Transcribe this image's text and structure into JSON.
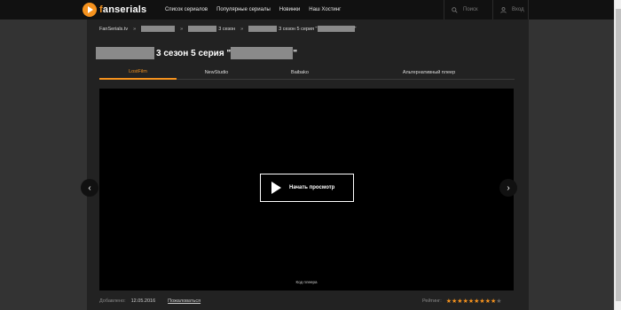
{
  "header": {
    "logo_prefix": "f",
    "logo_rest": "anserials",
    "nav": [
      "Список сериалов",
      "Популярные сериалы",
      "Новинки",
      "Наш Хостинг"
    ],
    "search_label": "Поиск",
    "login_label": "Вход"
  },
  "breadcrumb": {
    "home": "FanSerials.tv",
    "separator": "»",
    "season_suffix": "3 сезон",
    "episode_text": "3 сезон 5 серия \""
  },
  "title": {
    "text": "3 сезон 5 серия \"",
    "closing_quote": "\""
  },
  "tabs": [
    "LostFilm",
    "NewStudio",
    "Baibako",
    "Альтернативный плеер"
  ],
  "active_tab": 0,
  "player": {
    "play_label": "Начать просмотр",
    "code_label": "Код плеера"
  },
  "footer": {
    "added_label": "Добавлено:",
    "added_date": "12.05.2016",
    "complain_label": "Пожаловаться",
    "rating_label": "Рейтинг:",
    "rating_value": 9,
    "rating_max": 10
  },
  "colors": {
    "accent": "#f5921e",
    "header_bg": "#111111",
    "page_bg": "#333333",
    "content_bg": "#222222"
  },
  "icons": [
    "play-logo-icon",
    "search-icon",
    "user-icon",
    "play-icon",
    "chevron-left-icon",
    "chevron-right-icon",
    "star-icon"
  ]
}
